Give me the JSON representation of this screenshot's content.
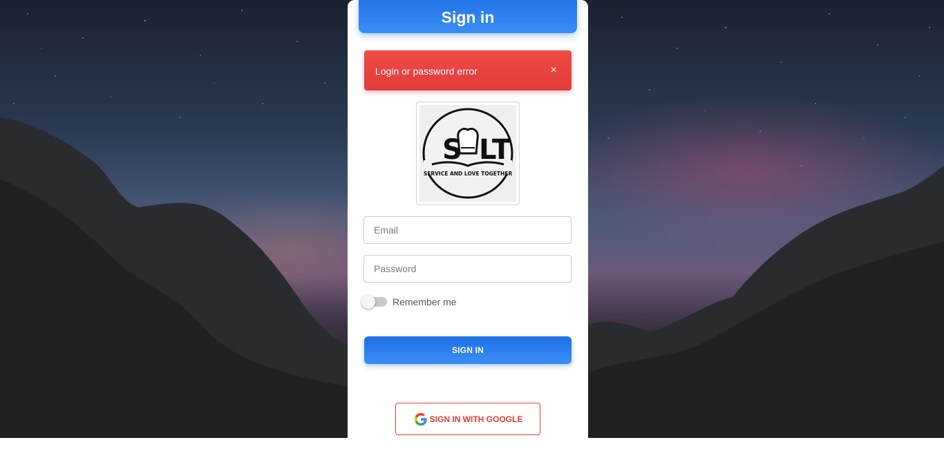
{
  "header": {
    "title": "Sign in"
  },
  "alert": {
    "message": "Login or password error",
    "close_symbol": "×",
    "color": "#e53935"
  },
  "logo": {
    "main_text_left": "S",
    "main_text_right": "LT",
    "tagline": "SERVICE AND LOVE TOGETHER"
  },
  "form": {
    "email_placeholder": "Email",
    "password_placeholder": "Password",
    "remember_label": "Remember me",
    "remember_checked": false,
    "submit_label": "SIGN IN"
  },
  "google": {
    "label": "SIGN IN WITH GOOGLE",
    "icon": "google-icon"
  },
  "colors": {
    "primary": "#2b7cee",
    "danger": "#e53935"
  }
}
